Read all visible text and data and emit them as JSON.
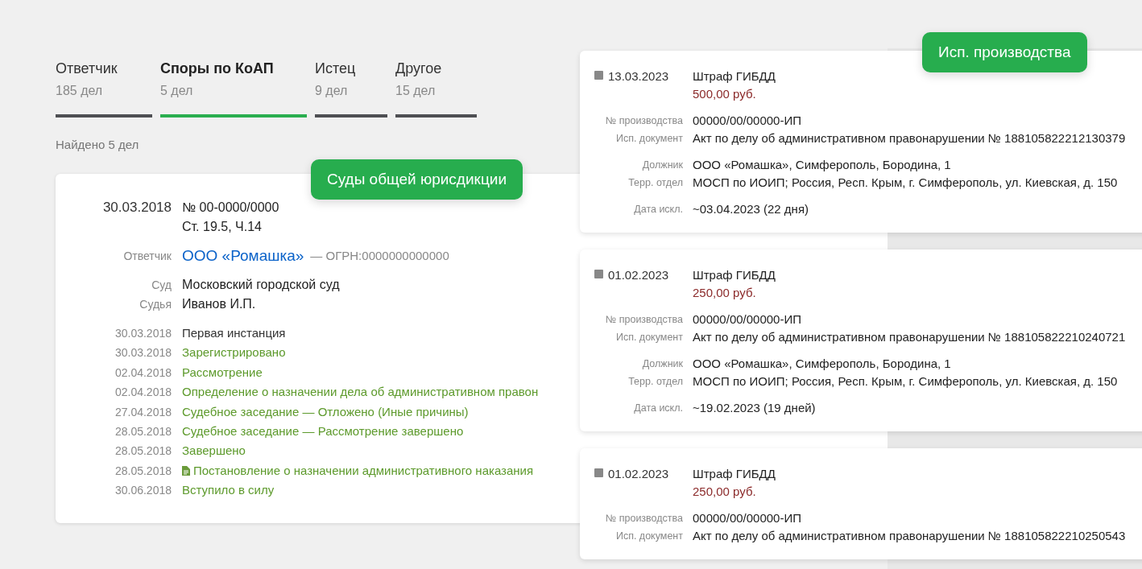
{
  "tabs": [
    {
      "label": "Ответчик",
      "count": "185 дел",
      "selected": false
    },
    {
      "label": "Споры по КоАП",
      "count": "5 дел",
      "selected": true
    },
    {
      "label": "Истец",
      "count": "9 дел",
      "selected": false
    },
    {
      "label": "Другое",
      "count": "15 дел",
      "selected": false
    }
  ],
  "found": "Найдено 5 дел",
  "court_badge": "Суды общей юрисдикции",
  "case": {
    "date": "30.03.2018",
    "number": "№ 00-0000/0000",
    "article": "Ст. 19.5, Ч.14",
    "field_groups": [
      [
        {
          "label": "Ответчик",
          "value": "ООО «Ромашка»",
          "note": "— ОГРН:0000000000000",
          "kind": "link"
        }
      ],
      [
        {
          "label": "Суд",
          "value": "Московский городской суд",
          "kind": "text"
        },
        {
          "label": "Судья",
          "value": "Иванов И.П.",
          "kind": "text"
        }
      ]
    ],
    "events": [
      {
        "date": "30.03.2018",
        "text": "Первая инстанция",
        "kind": "stage"
      },
      {
        "date": "30.03.2018",
        "text": "Зарегистрировано",
        "kind": "event"
      },
      {
        "date": "02.04.2018",
        "text": "Рассмотрение",
        "kind": "event"
      },
      {
        "date": "02.04.2018",
        "text": "Определение о назначении дела об административном правон",
        "kind": "event"
      },
      {
        "date": "27.04.2018",
        "text": "Судебное заседание — Отложено (Иные причины)",
        "kind": "event"
      },
      {
        "date": "28.05.2018",
        "text": "Судебное заседание — Рассмотрение завершено",
        "kind": "event"
      },
      {
        "date": "28.05.2018",
        "text": "Завершено",
        "kind": "event"
      },
      {
        "date": "28.05.2018",
        "text": "Постановление о назначении административного наказания",
        "kind": "document"
      },
      {
        "date": "30.06.2018",
        "text": "Вступило в силу",
        "kind": "event"
      }
    ]
  },
  "enforcement_badge": "Исп. производства",
  "enforcement": [
    {
      "date": "13.03.2023",
      "title": "Штраф ГИБДД",
      "amount": "500,00 руб.",
      "field_groups": [
        [
          {
            "label": "№ производства",
            "value": "00000/00/00000-ИП"
          },
          {
            "label": "Исп. документ",
            "value": "Акт по делу об административном правонарушении № 188105822212130379"
          }
        ],
        [
          {
            "label": "Должник",
            "value": "ООО «Ромашка», Симферополь, Бородина, 1"
          },
          {
            "label": "Терр. отдел",
            "value": "МОСП по ИОИП; Россия, Респ. Крым, г. Симферополь, ул. Киевская, д. 150"
          }
        ],
        [
          {
            "label": "Дата искл.",
            "value": "~03.04.2023 (22 дня)"
          }
        ]
      ]
    },
    {
      "date": "01.02.2023",
      "title": "Штраф ГИБДД",
      "amount": "250,00 руб.",
      "field_groups": [
        [
          {
            "label": "№ производства",
            "value": "00000/00/00000-ИП"
          },
          {
            "label": "Исп. документ",
            "value": "Акт по делу об административном правонарушении № 188105822210240721"
          }
        ],
        [
          {
            "label": "Должник",
            "value": "ООО «Ромашка», Симферополь, Бородина, 1"
          },
          {
            "label": "Терр. отдел",
            "value": "МОСП по ИОИП; Россия, Респ. Крым, г. Симферополь, ул. Киевская, д. 150"
          }
        ],
        [
          {
            "label": "Дата искл.",
            "value": "~19.02.2023 (19 дней)"
          }
        ]
      ]
    },
    {
      "date": "01.02.2023",
      "title": "Штраф ГИБДД",
      "amount": "250,00 руб.",
      "field_groups": [
        [
          {
            "label": "№ производства",
            "value": "00000/00/00000-ИП"
          },
          {
            "label": "Исп. документ",
            "value": "Акт по делу об административном правонарушении № 188105822210250543"
          }
        ]
      ]
    }
  ]
}
